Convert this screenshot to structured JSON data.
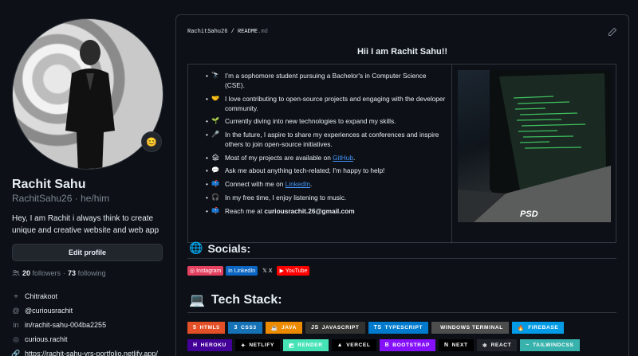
{
  "profile": {
    "name": "Rachit Sahu",
    "login": "RachitSahu26",
    "pronouns": "he/him",
    "status_emoji": "😊",
    "bio": "Hey, I am Rachit i always think to create unique and creative website and web app",
    "edit_label": "Edit profile",
    "followers_count": "20",
    "followers_label": "followers",
    "separator": "·",
    "following_count": "73",
    "following_label": "following",
    "details": [
      {
        "icon": "location-icon",
        "glyph": "⌖",
        "text": "Chitrakoot"
      },
      {
        "icon": "at-icon",
        "glyph": "@",
        "text": "@curiousrachit"
      },
      {
        "icon": "linkedin-icon",
        "glyph": "in",
        "text": "in/rachit-sahu-004ba2255"
      },
      {
        "icon": "instagram-icon",
        "glyph": "◎",
        "text": "curious.rachit"
      },
      {
        "icon": "link-icon",
        "glyph": "🔗",
        "text": "https://rachit-sahu-vrs-portfolio.netlify.app/"
      }
    ]
  },
  "readme": {
    "crumb_user": "RachitSahu26",
    "crumb_sep": " / ",
    "crumb_file": "README",
    "crumb_ext": ".md",
    "hello": "Hii I am Rachit Sahu!!",
    "bullets": [
      {
        "emoji": "🔭",
        "text": "I’m a sophomore student pursuing a Bachelor's in Computer Science (CSE)."
      },
      {
        "emoji": "🤝",
        "text": "I love contributing to open-source projects and engaging with the developer community."
      },
      {
        "emoji": "🌱",
        "text": "Currently diving into new technologies to expand my skills."
      },
      {
        "emoji": "🎤",
        "text": "In the future, I aspire to share my experiences at conferences and inspire others to join open-source initiatives."
      },
      {
        "emoji": "🏚",
        "pre": "Most of my projects are available on ",
        "link": "GitHub",
        "post": "."
      },
      {
        "emoji": "💬",
        "text": "Ask me about anything tech-related; I'm happy to help!"
      },
      {
        "emoji": "📫",
        "pre": "Connect with me on ",
        "link": "LinkedIn",
        "post": "."
      },
      {
        "emoji": "🎧",
        "text": "In my free time, I enjoy listening to music."
      },
      {
        "emoji": "📫",
        "pre": "Reach me at ",
        "bold": "curiousrachit.26@gmail.com",
        "post": ""
      }
    ],
    "image_label": "PSD",
    "socials_emoji": "🌐",
    "socials_title": "Socials:",
    "socials": [
      {
        "label": "Instagram",
        "color": "#e4405f",
        "glyph": "◎"
      },
      {
        "label": "LinkedIn",
        "color": "#0a66c2",
        "glyph": "in"
      },
      {
        "label": "X",
        "color": "#0d1117",
        "glyph": "𝕏"
      },
      {
        "label": "YouTube",
        "color": "#ff0000",
        "glyph": "▶"
      }
    ],
    "tech_emoji": "💻",
    "tech_title": "Tech Stack:",
    "tech_row1": [
      {
        "label": "HTML5",
        "color": "#e34f26",
        "glyph": "5"
      },
      {
        "label": "CSS3",
        "color": "#1572b6",
        "glyph": "3"
      },
      {
        "label": "JAVA",
        "color": "#ed8b00",
        "glyph": "☕"
      },
      {
        "label": "JAVASCRIPT",
        "color": "#323330",
        "glyph": "JS"
      },
      {
        "label": "TYPESCRIPT",
        "color": "#007acc",
        "glyph": "TS"
      },
      {
        "label": "WINDOWS TERMINAL",
        "color": "#4d4d4d",
        "glyph": ""
      },
      {
        "label": "FIREBASE",
        "color": "#039be5",
        "glyph": "🔥"
      }
    ],
    "tech_row2": [
      {
        "label": "HEROKU",
        "color": "#430098",
        "glyph": "H"
      },
      {
        "label": "NETLIFY",
        "color": "#000000",
        "glyph": "✦"
      },
      {
        "label": "RENDER",
        "color": "#46e3b7",
        "glyph": "◩"
      },
      {
        "label": "VERCEL",
        "color": "#000000",
        "glyph": "▲"
      },
      {
        "label": "BOOTSTRAP",
        "color": "#8511fa",
        "glyph": "B"
      },
      {
        "label": "NEXT",
        "color": "#000000",
        "glyph": "N"
      },
      {
        "label": "REACT",
        "color": "#20232a",
        "glyph": "⚛"
      },
      {
        "label": "TAILWINDCSS",
        "color": "#38b2ac",
        "glyph": "~"
      }
    ]
  }
}
